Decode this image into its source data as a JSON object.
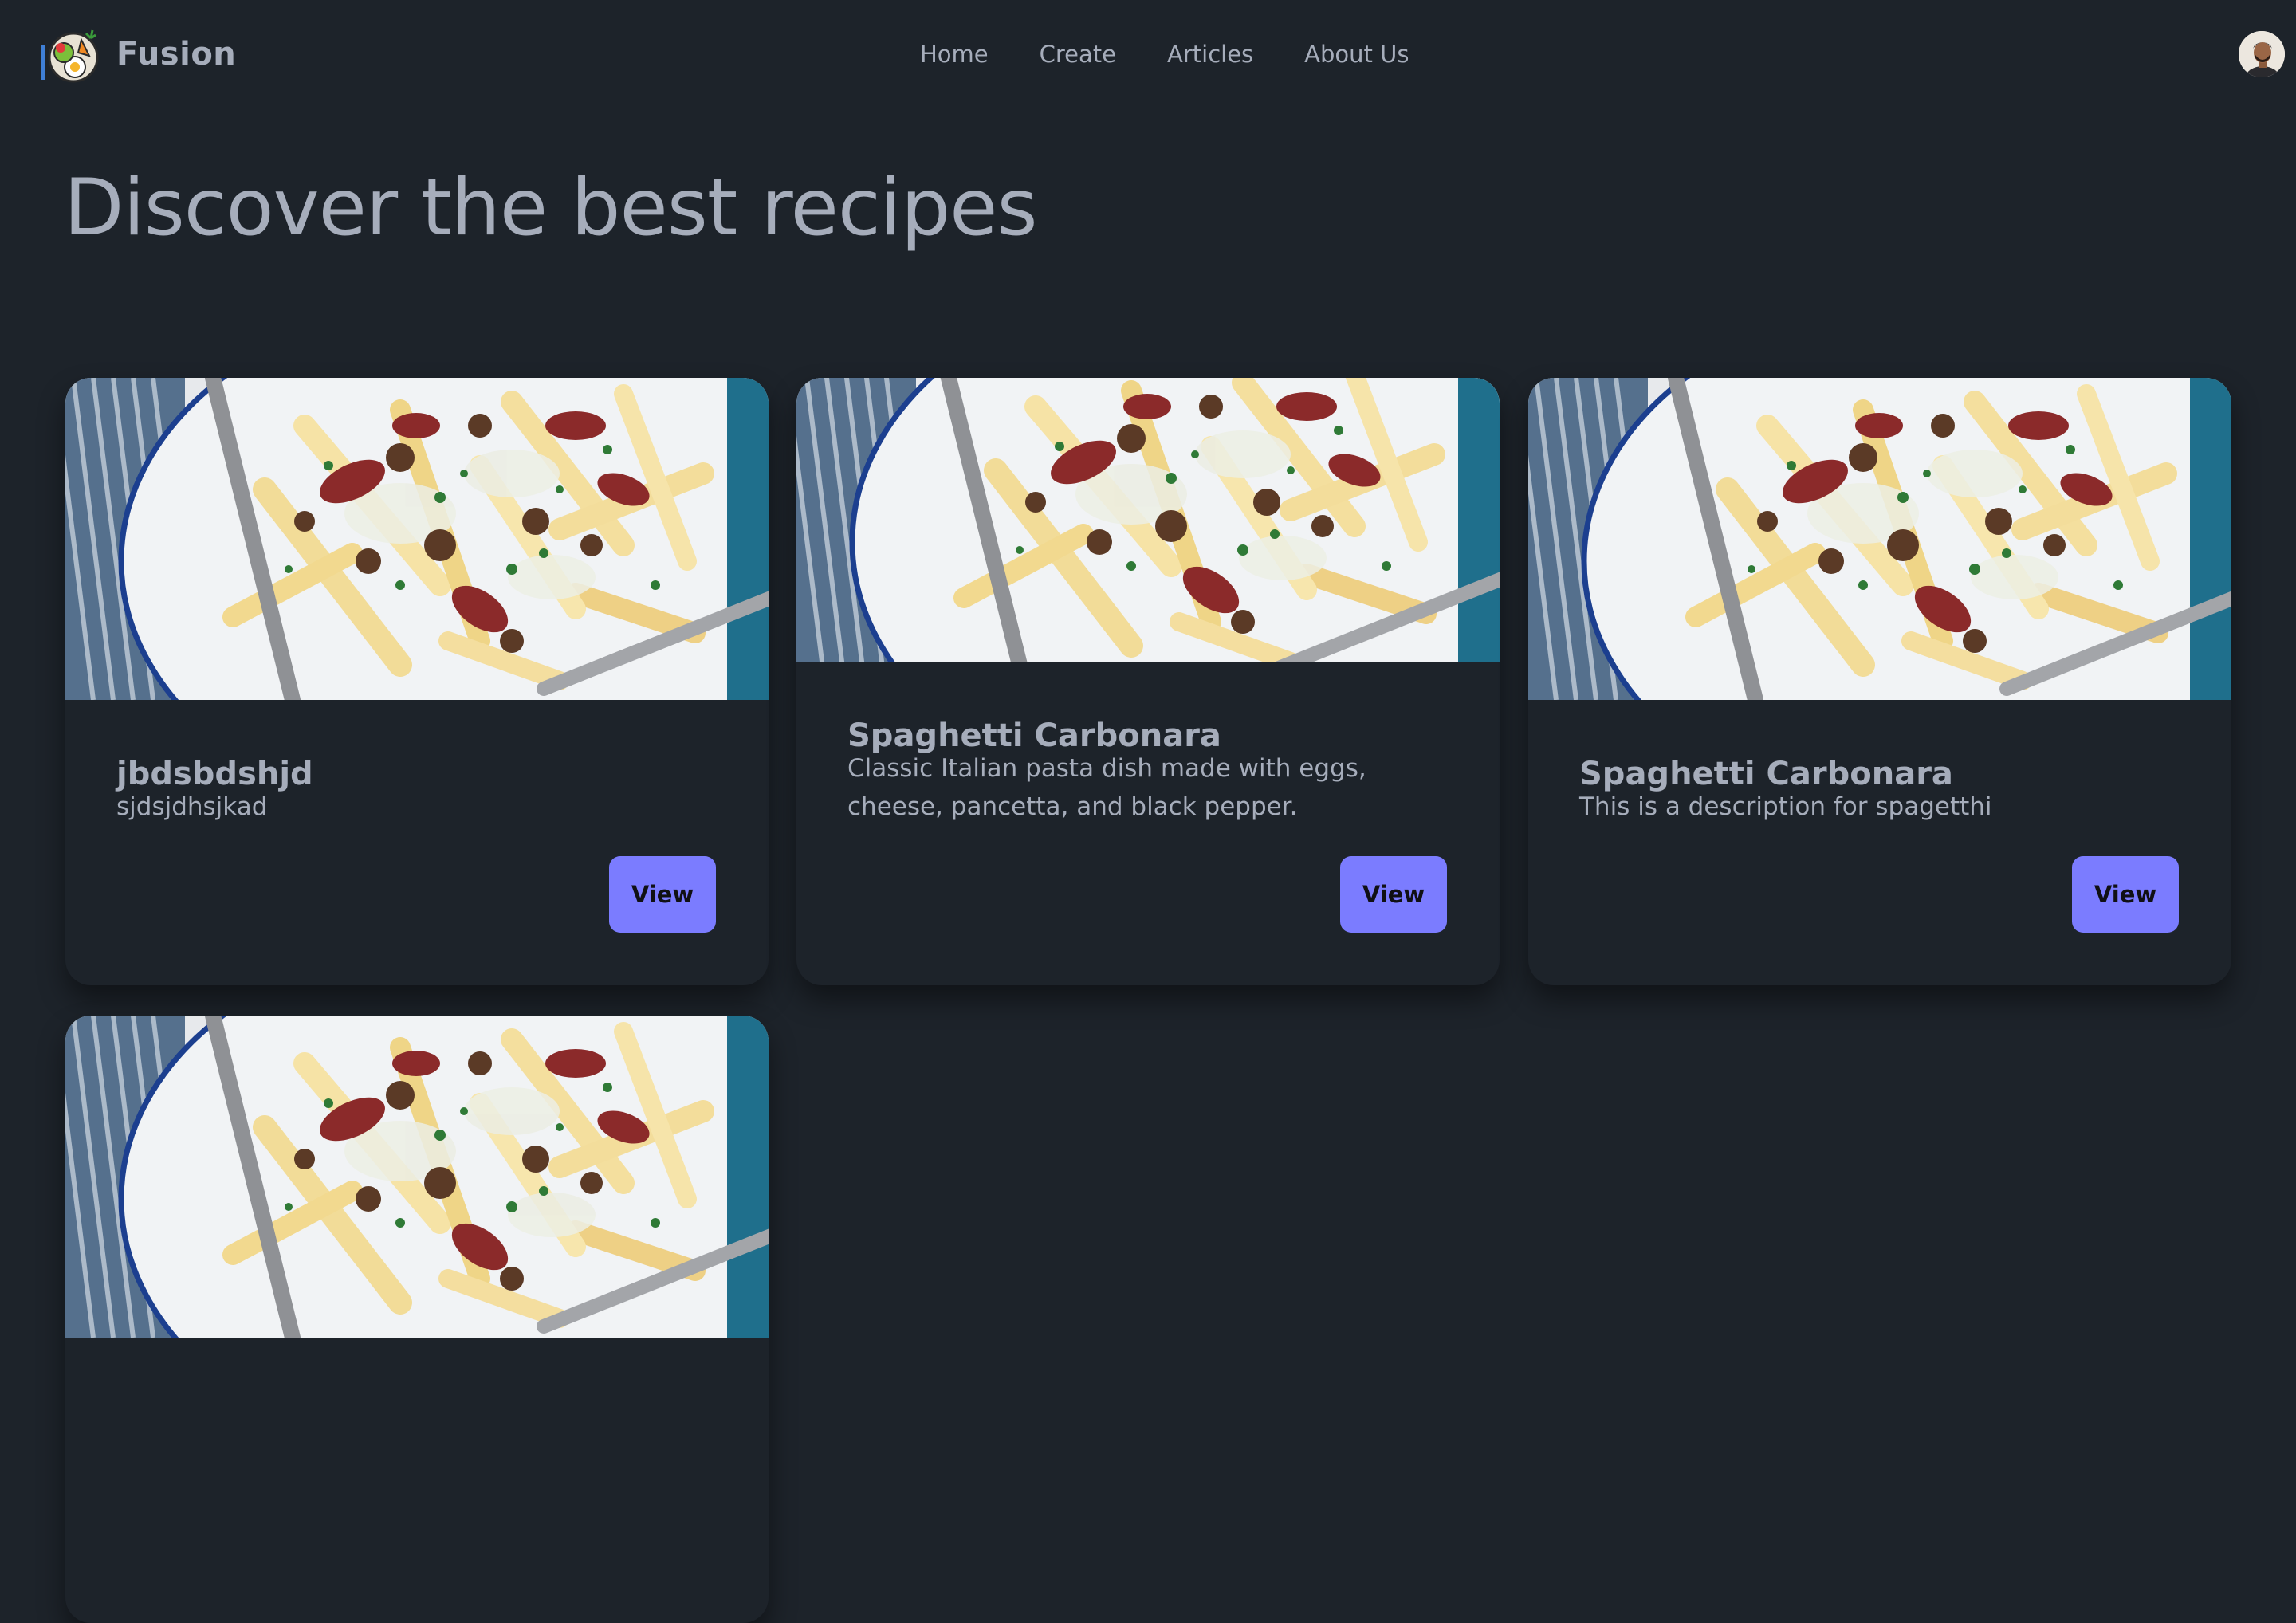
{
  "brand": {
    "name": "Fusion",
    "logo_icon": "food-logo-icon"
  },
  "nav": {
    "links": [
      {
        "label": "Home"
      },
      {
        "label": "Create"
      },
      {
        "label": "Articles"
      },
      {
        "label": "About Us"
      }
    ]
  },
  "header": {
    "title": "Discover the best recipes"
  },
  "recipes": [
    {
      "title": "jbdsbdshjd",
      "description": "sjdsjdhsjkad",
      "button_label": "View"
    },
    {
      "title": "Spaghetti Carbonara",
      "description": "Classic Italian pasta dish made with eggs, cheese, pancetta, and black pepper.",
      "button_label": "View"
    },
    {
      "title": "Spaghetti Carbonara",
      "description": "This is a description for spagetthi",
      "button_label": "View"
    }
  ],
  "colors": {
    "background": "#1d232a",
    "text": "#a6adbb",
    "primary_button": "#7b7cff"
  }
}
